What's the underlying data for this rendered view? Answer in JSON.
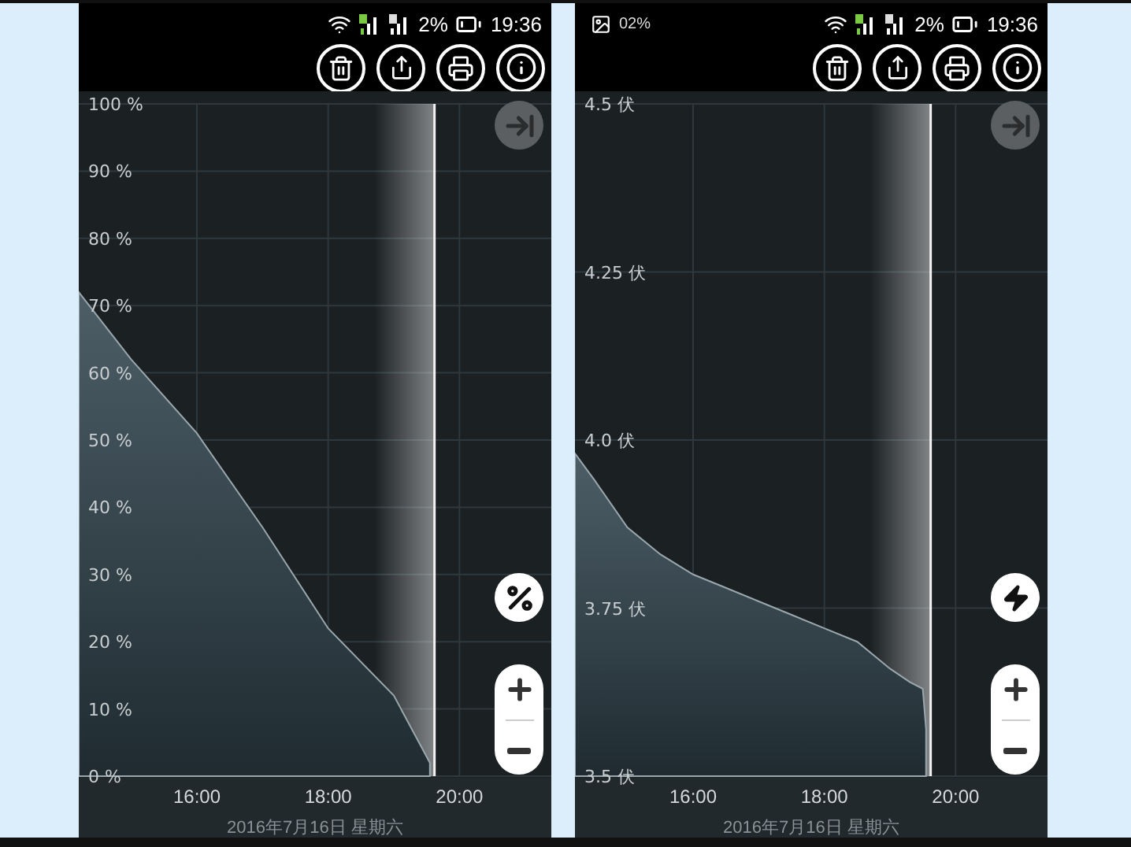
{
  "phones": [
    {
      "status_bar": {
        "battery_text": "2%",
        "time": "19:36"
      },
      "kind": "percent",
      "chart_data": {
        "type": "area",
        "grid": true,
        "x": [
          14.2,
          15,
          16,
          17,
          18,
          19,
          19.55
        ],
        "series": [
          {
            "color": "#9aa8ae",
            "values": [
              72,
              62,
              51,
              37,
              22,
              12,
              2
            ]
          }
        ],
        "xlim": [
          14.2,
          21.4
        ],
        "ylim": [
          0,
          100
        ],
        "xticks": [
          {
            "value": 16,
            "label": "16:00"
          },
          {
            "value": 18,
            "label": "18:00"
          },
          {
            "value": 20,
            "label": "20:00"
          }
        ],
        "yticks": [
          {
            "value": 100,
            "label": "100 %"
          },
          {
            "value": 90,
            "label": "90 %"
          },
          {
            "value": 80,
            "label": "80 %"
          },
          {
            "value": 70,
            "label": "70 %"
          },
          {
            "value": 60,
            "label": "60 %"
          },
          {
            "value": 50,
            "label": "50 %"
          },
          {
            "value": 40,
            "label": "40 %"
          },
          {
            "value": 30,
            "label": "30 %"
          },
          {
            "value": 20,
            "label": "20 %"
          },
          {
            "value": 10,
            "label": "10 %"
          },
          {
            "value": 0,
            "label": "0 %"
          }
        ],
        "ref_lines": [
          {
            "axis": "x",
            "value": 19.62,
            "color": "#f2f2f2"
          }
        ],
        "bands": [
          {
            "axis": "x",
            "from": 18.7,
            "to": 19.62
          }
        ]
      },
      "date": "2016年7月16日 星期六"
    },
    {
      "status_bar": {
        "notification_text": "02%",
        "battery_text": "2%",
        "time": "19:36"
      },
      "kind": "voltage",
      "chart_data": {
        "type": "area",
        "grid": true,
        "x": [
          14.2,
          14.5,
          15,
          15.5,
          16,
          16.5,
          17,
          17.5,
          18,
          18.5,
          19,
          19.3,
          19.5,
          19.55
        ],
        "series": [
          {
            "color": "#9aa8ae",
            "values": [
              3.98,
              3.94,
              3.87,
              3.83,
              3.8,
              3.78,
              3.76,
              3.74,
              3.72,
              3.7,
              3.66,
              3.64,
              3.63,
              3.57
            ]
          }
        ],
        "xlim": [
          14.2,
          21.4
        ],
        "ylim": [
          3.5,
          4.5
        ],
        "xticks": [
          {
            "value": 16,
            "label": "16:00"
          },
          {
            "value": 18,
            "label": "18:00"
          },
          {
            "value": 20,
            "label": "20:00"
          }
        ],
        "yticks": [
          {
            "value": 4.5,
            "label": "4.5 伏"
          },
          {
            "value": 4.25,
            "label": "4.25 伏"
          },
          {
            "value": 4.0,
            "label": "4.0 伏"
          },
          {
            "value": 3.75,
            "label": "3.75 伏"
          },
          {
            "value": 3.5,
            "label": "3.5 伏"
          }
        ],
        "ref_lines": [
          {
            "axis": "x",
            "value": 19.62,
            "color": "#f2f2f2"
          }
        ],
        "bands": [
          {
            "axis": "x",
            "from": 18.7,
            "to": 19.62
          }
        ]
      },
      "date": "2016年7月16日 星期六"
    }
  ]
}
